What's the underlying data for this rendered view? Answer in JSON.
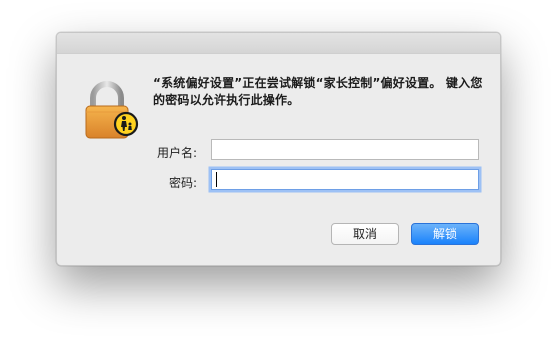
{
  "dialog": {
    "message": "“系统偏好设置”正在尝试解锁“家长控制”偏好设置。 键入您的密码以允许执行此操作。",
    "icon": "parental-controls-lock-icon"
  },
  "form": {
    "username_label": "用户名:",
    "username_value": "",
    "password_label": "密码:",
    "password_value": ""
  },
  "buttons": {
    "cancel_label": "取消",
    "unlock_label": "解锁"
  },
  "colors": {
    "accent": "#1a82fb",
    "lock_gold": "#f0a23a",
    "badge_yellow": "#ffd21f"
  }
}
